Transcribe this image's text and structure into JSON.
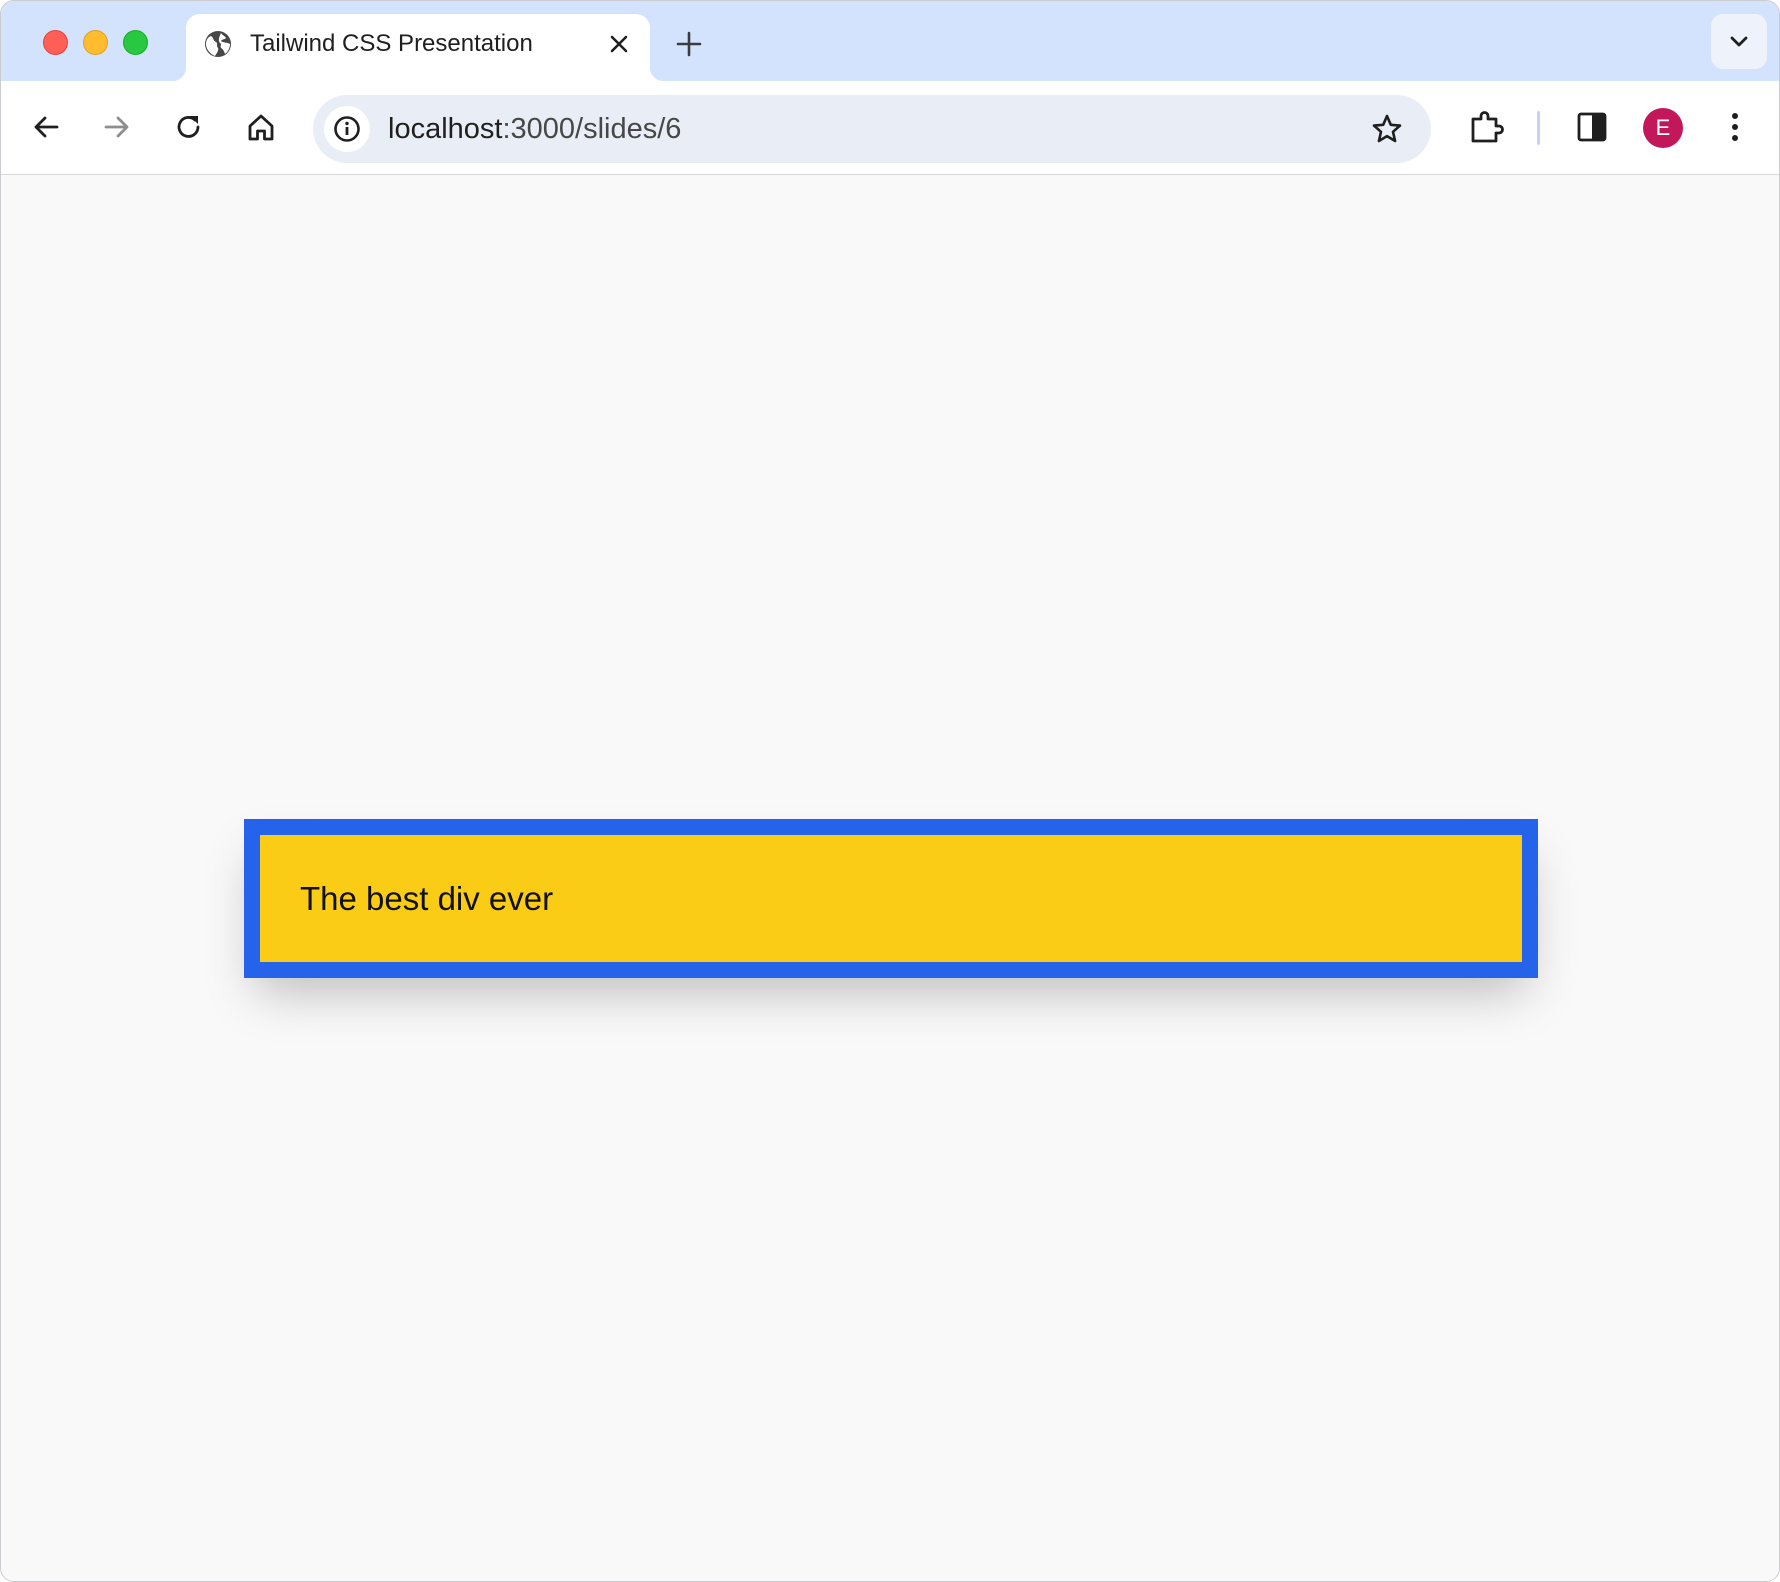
{
  "window": {
    "controls": [
      "close",
      "minimize",
      "zoom"
    ]
  },
  "tabs": [
    {
      "title": "Tailwind CSS Presentation",
      "favicon": "globe-icon",
      "active": true
    }
  ],
  "toolbar": {
    "back_icon": "arrow-left-icon",
    "forward_icon": "arrow-right-icon",
    "reload_icon": "reload-icon",
    "home_icon": "home-icon",
    "extensions_icon": "puzzle-icon",
    "side_panel_icon": "side-panel-icon",
    "menu_icon": "kebab-menu-icon"
  },
  "omnibox": {
    "host": "localhost",
    "path": ":3000/slides/6",
    "site_info_icon": "info-icon",
    "bookmark_icon": "star-icon"
  },
  "profile": {
    "initial": "E",
    "color": "#c2185b"
  },
  "content": {
    "box_text": "The best div ever",
    "box_background": "#facc15",
    "box_border": "#2563eb",
    "page_background": "#f9f9f9"
  }
}
